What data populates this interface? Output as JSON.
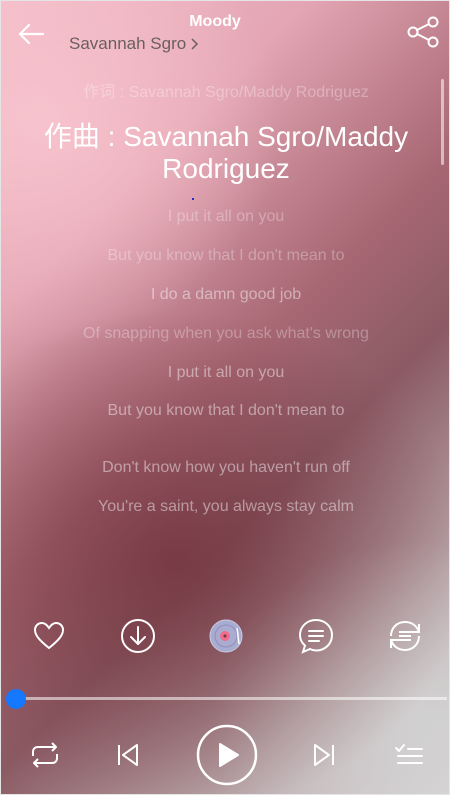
{
  "header": {
    "title": "Moody",
    "artist": "Savannah Sgro"
  },
  "lyrics": {
    "lyricist_line": "作词 : Savannah Sgro/Maddy Rodriguez",
    "composer_line": "作曲 : Savannah Sgro/Maddy Rodriguez",
    "lines": [
      "I put it all on you",
      "But you know that I don't mean to",
      "I do a damn good job",
      "Of snapping when you ask what's wrong",
      "I put it all on you",
      "But you know that I don't mean to",
      "Don't know how you haven't run off",
      "You're a saint, you always stay calm"
    ]
  },
  "actions": {
    "icons": [
      "heart-icon",
      "download-icon",
      "disc-icon",
      "comment-icon",
      "repeat-list-icon"
    ]
  },
  "playback": {
    "progress": 0.0
  },
  "controls": {
    "icons": [
      "repeat-icon",
      "previous-icon",
      "play-icon",
      "next-icon",
      "playlist-icon"
    ]
  },
  "colors": {
    "accent": "#1677ff",
    "artist_text": "#6b5e61"
  }
}
